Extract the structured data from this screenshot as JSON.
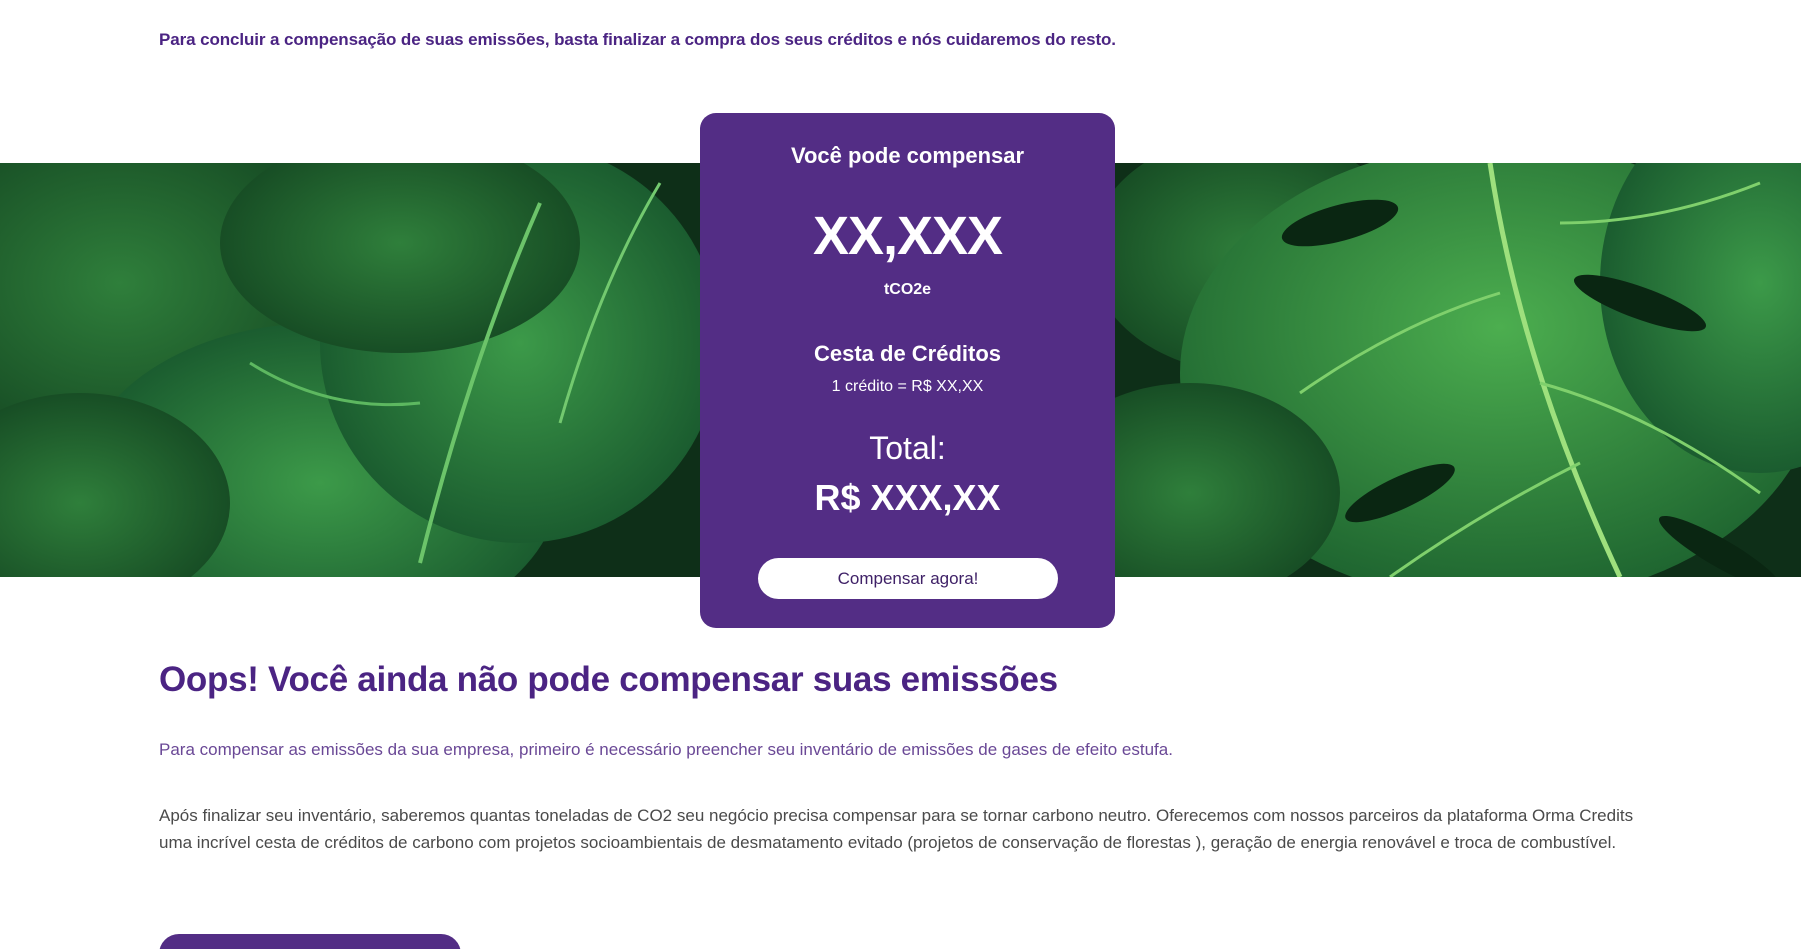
{
  "intro_text": "Para concluir a compensação de suas emissões, basta finalizar a compra dos seus créditos e nós cuidaremos do resto.",
  "card": {
    "title": "Você pode compensar",
    "amount": "XX,XXX",
    "unit": "tCO2e",
    "basket_title": "Cesta de Créditos",
    "rate": "1 crédito = R$ XX,XX",
    "total_label": "Total:",
    "total_value": "R$ XXX,XX",
    "button_label": "Compensar agora!"
  },
  "oops_heading": "Oops! Você ainda não pode compensar suas emissões",
  "paragraph_1": "Para compensar as emissões da sua empresa, primeiro é necessário preencher seu inventário de emissões de gases de efeito estufa.",
  "paragraph_2": "Após finalizar seu inventário, saberemos quantas toneladas de CO2 seu negócio precisa compensar para se tornar carbono neutro. Oferecemos com nossos parceiros da plataforma Orma Credits uma incrível cesta de créditos de carbono com projetos socioambientais de desmatamento evitado (projetos de conservação de florestas ), geração de energia renovável e troca de combustível.",
  "colors": {
    "brand_purple": "#532d85",
    "heading_purple": "#4b2483",
    "leaf_green": "#2f8a3c"
  }
}
